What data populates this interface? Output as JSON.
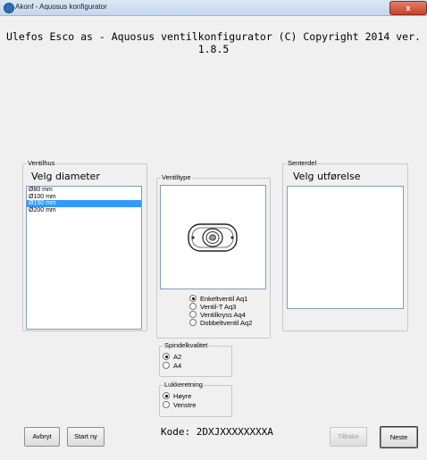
{
  "window": {
    "title": "Akonf - Aquosus konfigurator",
    "close_glyph": "x"
  },
  "header": {
    "text": "Ulefos Esco as - Aquosus ventilkonfigurator (C) Copyright 2014 ver. 1.8.5"
  },
  "ventilhus": {
    "legend": "Ventilhus",
    "heading": "Velg diameter",
    "items": [
      "Ø80 mm",
      "Ø100 mm",
      "Ø150 mm",
      "Ø200 mm"
    ],
    "selected": "Ø150 mm"
  },
  "ventiltype": {
    "legend": "Ventiltype",
    "options": [
      "Enkeltventil Aq1",
      "Ventil-T Aq3",
      "Ventilkryss Aq4",
      "Dobbeltventil Aq2"
    ],
    "selected": "Enkeltventil Aq1"
  },
  "senterdel": {
    "legend": "Senterdel",
    "heading": "Velg utførelse"
  },
  "spindelkvalitet": {
    "legend": "Spindelkvalitet",
    "options": [
      "A2",
      "A4"
    ],
    "selected": "A2"
  },
  "lukkeretning": {
    "legend": "Lukkeretning",
    "options": [
      "Høyre",
      "Venstre"
    ],
    "selected": "Høyre"
  },
  "footer": {
    "avbryt": "Avbryt",
    "start_ny": "Start ny",
    "kode": "Kode: 2DXJXXXXXXXXA",
    "tilbake": "Tilbake",
    "neste": "Neste"
  }
}
